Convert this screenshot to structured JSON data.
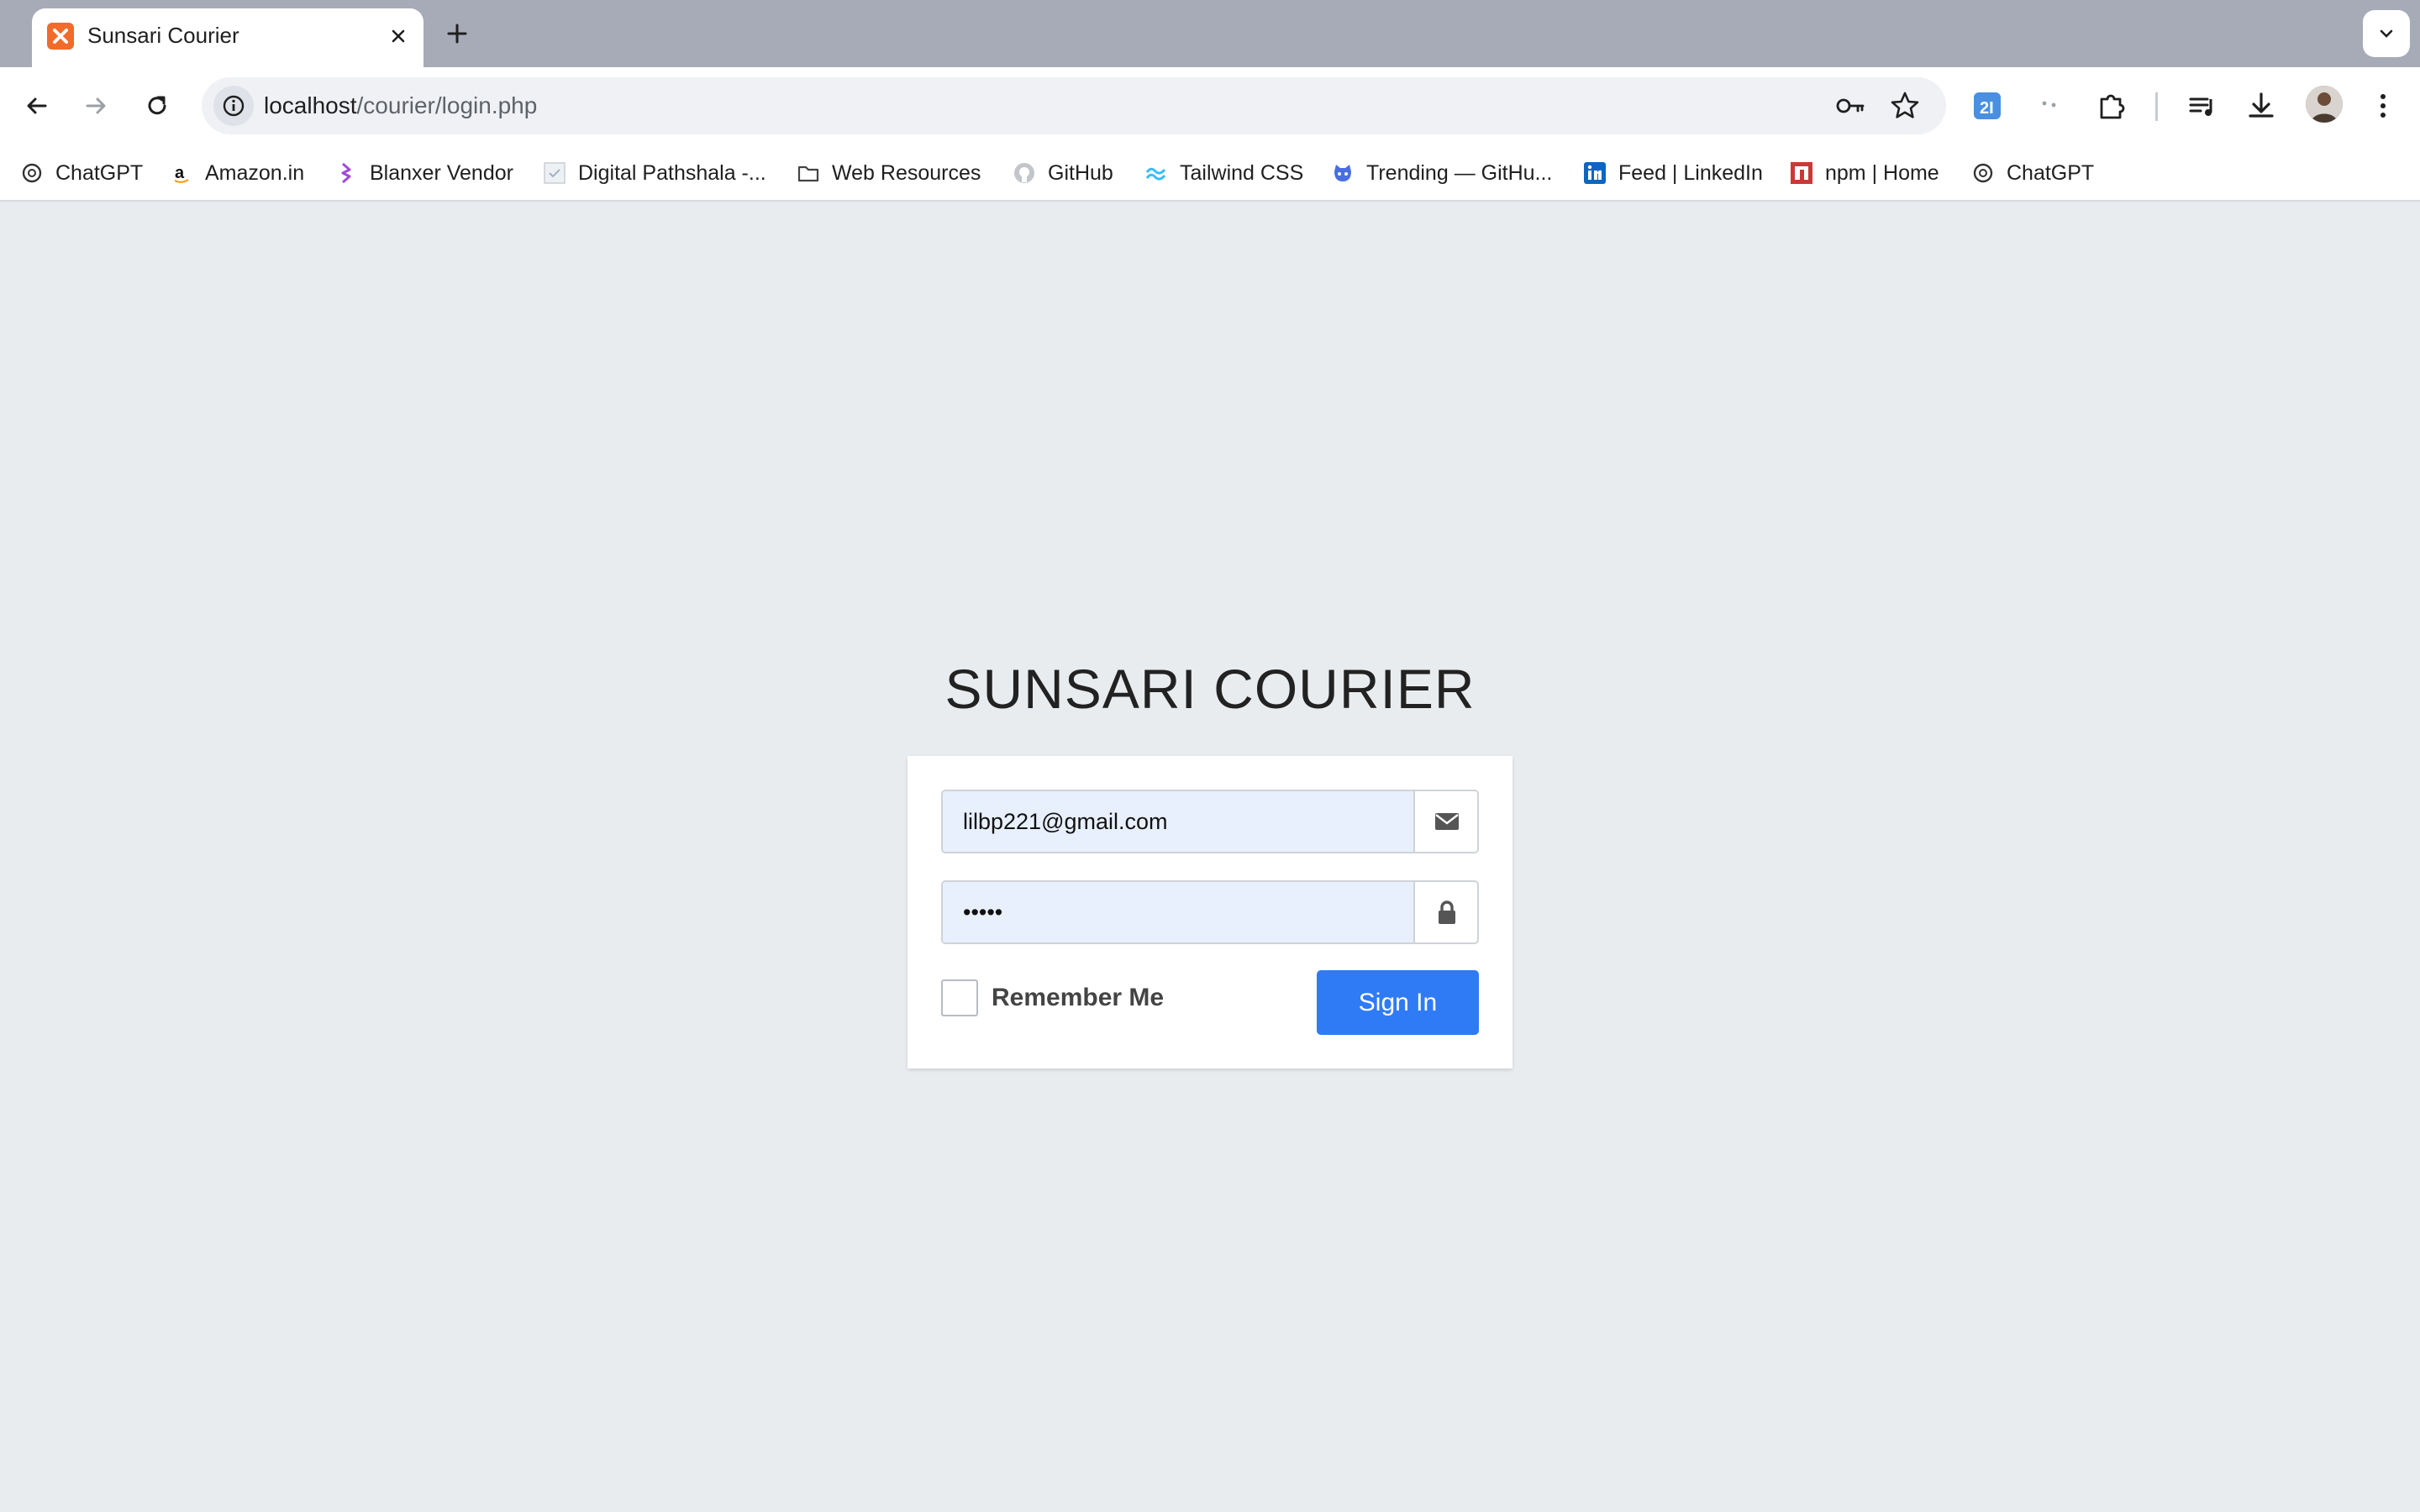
{
  "browser": {
    "tab": {
      "title": "Sunsari Courier",
      "close_symbol": "✕",
      "new_tab_symbol": "+"
    },
    "address": {
      "host": "localhost",
      "path": "/courier/login.php"
    },
    "bookmarks": [
      {
        "label": "ChatGPT",
        "icon": "chatgpt-icon"
      },
      {
        "label": "Amazon.in",
        "icon": "amazon-icon"
      },
      {
        "label": "Blanxer Vendor",
        "icon": "blanxer-icon"
      },
      {
        "label": "Digital Pathshala -...",
        "icon": "page-icon"
      },
      {
        "label": "Web Resources",
        "icon": "folder-icon"
      },
      {
        "label": "GitHub",
        "icon": "github-icon"
      },
      {
        "label": "Tailwind CSS",
        "icon": "tailwind-icon"
      },
      {
        "label": "Trending — GitHu...",
        "icon": "octocat-icon"
      },
      {
        "label": "Feed | LinkedIn",
        "icon": "linkedin-icon"
      },
      {
        "label": "npm | Home",
        "icon": "npm-icon"
      },
      {
        "label": "ChatGPT",
        "icon": "chatgpt-icon"
      }
    ]
  },
  "login": {
    "brand": "SUNSARI COURIER",
    "email_value": "lilbp221@gmail.com",
    "password_value": "•••••",
    "remember_label": "Remember Me",
    "signin_label": "Sign In"
  },
  "colors": {
    "page_background": "#e9ecef",
    "tabstrip": "#a7aab7",
    "autofill_input": "#e8f0fe",
    "signin_button": "#2f7bf5"
  }
}
